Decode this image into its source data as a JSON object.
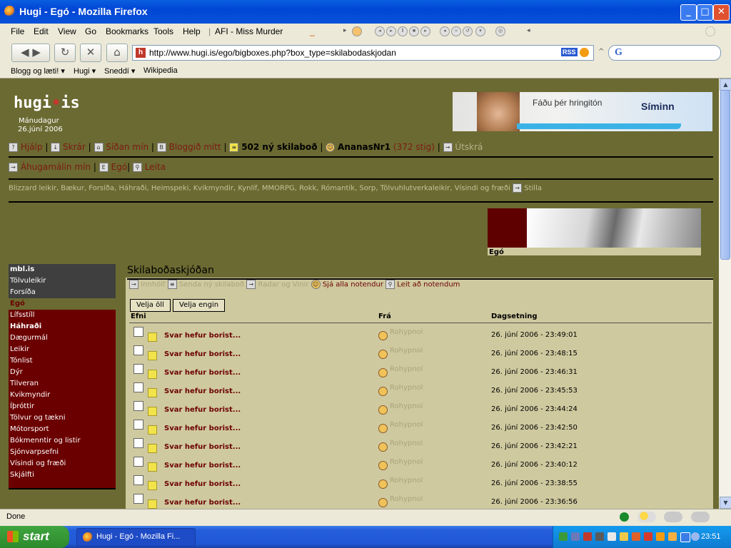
{
  "window": {
    "title": "Hugi - Egó - Mozilla Firefox",
    "minimize": "_",
    "maximize": "□",
    "close": "✕"
  },
  "menu": {
    "items": [
      "File",
      "Edit",
      "View",
      "Go",
      "Bookmarks",
      "Tools",
      "Help"
    ],
    "now_playing": "AFI - Miss Murder",
    "np_dash": "_"
  },
  "nav": {
    "back": "◀",
    "forward": "▶",
    "reload": "↻",
    "stop": "✕",
    "home": "⌂",
    "url": "http://www.hugi.is/ego/bigboxes.php?box_type=skilabodaskjodan",
    "rss": "RSS",
    "search_logo": "G"
  },
  "bookmarks": [
    "Blogg og læti! ▾",
    "Hugi ▾",
    "Sneddí ▾",
    "Wikipedia"
  ],
  "site": {
    "logo_a": "hugi",
    "logo_dot": "•",
    "logo_b": "is",
    "day": "Mánudagur",
    "date": "26.júní 2006",
    "banner_text": "Fáðu þér hringitón",
    "banner_brand": "Síminn"
  },
  "usernav": {
    "help": "Hjálp",
    "files": "Skrár",
    "mypage": "Síðan mín",
    "myblog": "Bloggið mitt",
    "new_messages": "502 ný skilaboð",
    "username": "AnanasNr1",
    "points": "(372 stig)",
    "logout": "Útskrá",
    "interests": "Áhugamálin mín",
    "ego": "Egó",
    "search": "Leita",
    "sep": "|"
  },
  "categories": {
    "list": "Blizzard leikir, Bækur, Forsíða, Háhraði, Heimspeki, Kvikmyndir, Kynlíf, MMORPG, Rokk, Rómantík, Sorp, Tölvuhlutverkaleikir, Vísindi og fræði",
    "settings": "Stilla"
  },
  "ego_header": {
    "label": "Egó"
  },
  "sidebar": {
    "grey": [
      "mbl.is",
      "Tölvuleikir",
      "Forsíða"
    ],
    "current": "Egó",
    "red": [
      "Lífsstíll",
      "Háhraði",
      "Dægurmál",
      "Leikir",
      "Tónlist",
      "Dýr",
      "Tilveran",
      "Kvikmyndir",
      "Íþróttir",
      "Tölvur og tækni",
      "Mótorsport",
      "Bókmenntir og listir",
      "Sjónvarpsefni",
      "Vísindi og fræði",
      "Skjálfti"
    ]
  },
  "panel": {
    "title": "Skilaboðaskjóðan",
    "inbox": "Innhólf",
    "send_new": "Senda ný skilaboð",
    "radar": "Radar og Vinir",
    "see_all": "Sjá alla notendur",
    "find_users": "Leit að notendum",
    "select_all": "Velja öll",
    "select_none": "Velja engin",
    "col_subject": "Efni",
    "col_from": "Frá",
    "col_date": "Dagsetning"
  },
  "messages": [
    {
      "subject": "Svar hefur borist...",
      "from": "Rohypnol",
      "date": "26. júní 2006 - 23:49:01"
    },
    {
      "subject": "Svar hefur borist...",
      "from": "Rohypnol",
      "date": "26. júní 2006 - 23:48:15"
    },
    {
      "subject": "Svar hefur borist...",
      "from": "Rohypnol",
      "date": "26. júní 2006 - 23:46:31"
    },
    {
      "subject": "Svar hefur borist...",
      "from": "Rohypnol",
      "date": "26. júní 2006 - 23:45:53"
    },
    {
      "subject": "Svar hefur borist...",
      "from": "Rohypnol",
      "date": "26. júní 2006 - 23:44:24"
    },
    {
      "subject": "Svar hefur borist...",
      "from": "Rohypnol",
      "date": "26. júní 2006 - 23:42:50"
    },
    {
      "subject": "Svar hefur borist...",
      "from": "Rohypnol",
      "date": "26. júní 2006 - 23:42:21"
    },
    {
      "subject": "Svar hefur borist...",
      "from": "Rohypnol",
      "date": "26. júní 2006 - 23:40:12"
    },
    {
      "subject": "Svar hefur borist...",
      "from": "Rohypnol",
      "date": "26. júní 2006 - 23:38:55"
    },
    {
      "subject": "Svar hefur borist...",
      "from": "Rohypnol",
      "date": "26. júní 2006 - 23:36:56"
    }
  ],
  "status": {
    "text": "Done"
  },
  "taskbar": {
    "start": "start",
    "item": "Hugi - Egó - Mozilla Fi...",
    "clock": "23:51"
  },
  "colors": {
    "page_bg": "#6b6a32",
    "panel_bg": "#cfc99f",
    "accent_red": "#6b0000",
    "link_red": "#7c1a12"
  }
}
